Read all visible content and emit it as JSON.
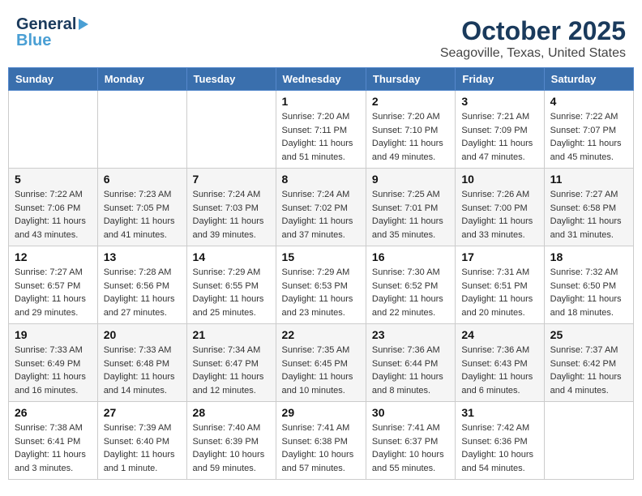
{
  "header": {
    "logo_line1": "General",
    "logo_line2": "Blue",
    "title": "October 2025",
    "subtitle": "Seagoville, Texas, United States"
  },
  "weekdays": [
    "Sunday",
    "Monday",
    "Tuesday",
    "Wednesday",
    "Thursday",
    "Friday",
    "Saturday"
  ],
  "weeks": [
    [
      {
        "day": "",
        "info": ""
      },
      {
        "day": "",
        "info": ""
      },
      {
        "day": "",
        "info": ""
      },
      {
        "day": "1",
        "info": "Sunrise: 7:20 AM\nSunset: 7:11 PM\nDaylight: 11 hours\nand 51 minutes."
      },
      {
        "day": "2",
        "info": "Sunrise: 7:20 AM\nSunset: 7:10 PM\nDaylight: 11 hours\nand 49 minutes."
      },
      {
        "day": "3",
        "info": "Sunrise: 7:21 AM\nSunset: 7:09 PM\nDaylight: 11 hours\nand 47 minutes."
      },
      {
        "day": "4",
        "info": "Sunrise: 7:22 AM\nSunset: 7:07 PM\nDaylight: 11 hours\nand 45 minutes."
      }
    ],
    [
      {
        "day": "5",
        "info": "Sunrise: 7:22 AM\nSunset: 7:06 PM\nDaylight: 11 hours\nand 43 minutes."
      },
      {
        "day": "6",
        "info": "Sunrise: 7:23 AM\nSunset: 7:05 PM\nDaylight: 11 hours\nand 41 minutes."
      },
      {
        "day": "7",
        "info": "Sunrise: 7:24 AM\nSunset: 7:03 PM\nDaylight: 11 hours\nand 39 minutes."
      },
      {
        "day": "8",
        "info": "Sunrise: 7:24 AM\nSunset: 7:02 PM\nDaylight: 11 hours\nand 37 minutes."
      },
      {
        "day": "9",
        "info": "Sunrise: 7:25 AM\nSunset: 7:01 PM\nDaylight: 11 hours\nand 35 minutes."
      },
      {
        "day": "10",
        "info": "Sunrise: 7:26 AM\nSunset: 7:00 PM\nDaylight: 11 hours\nand 33 minutes."
      },
      {
        "day": "11",
        "info": "Sunrise: 7:27 AM\nSunset: 6:58 PM\nDaylight: 11 hours\nand 31 minutes."
      }
    ],
    [
      {
        "day": "12",
        "info": "Sunrise: 7:27 AM\nSunset: 6:57 PM\nDaylight: 11 hours\nand 29 minutes."
      },
      {
        "day": "13",
        "info": "Sunrise: 7:28 AM\nSunset: 6:56 PM\nDaylight: 11 hours\nand 27 minutes."
      },
      {
        "day": "14",
        "info": "Sunrise: 7:29 AM\nSunset: 6:55 PM\nDaylight: 11 hours\nand 25 minutes."
      },
      {
        "day": "15",
        "info": "Sunrise: 7:29 AM\nSunset: 6:53 PM\nDaylight: 11 hours\nand 23 minutes."
      },
      {
        "day": "16",
        "info": "Sunrise: 7:30 AM\nSunset: 6:52 PM\nDaylight: 11 hours\nand 22 minutes."
      },
      {
        "day": "17",
        "info": "Sunrise: 7:31 AM\nSunset: 6:51 PM\nDaylight: 11 hours\nand 20 minutes."
      },
      {
        "day": "18",
        "info": "Sunrise: 7:32 AM\nSunset: 6:50 PM\nDaylight: 11 hours\nand 18 minutes."
      }
    ],
    [
      {
        "day": "19",
        "info": "Sunrise: 7:33 AM\nSunset: 6:49 PM\nDaylight: 11 hours\nand 16 minutes."
      },
      {
        "day": "20",
        "info": "Sunrise: 7:33 AM\nSunset: 6:48 PM\nDaylight: 11 hours\nand 14 minutes."
      },
      {
        "day": "21",
        "info": "Sunrise: 7:34 AM\nSunset: 6:47 PM\nDaylight: 11 hours\nand 12 minutes."
      },
      {
        "day": "22",
        "info": "Sunrise: 7:35 AM\nSunset: 6:45 PM\nDaylight: 11 hours\nand 10 minutes."
      },
      {
        "day": "23",
        "info": "Sunrise: 7:36 AM\nSunset: 6:44 PM\nDaylight: 11 hours\nand 8 minutes."
      },
      {
        "day": "24",
        "info": "Sunrise: 7:36 AM\nSunset: 6:43 PM\nDaylight: 11 hours\nand 6 minutes."
      },
      {
        "day": "25",
        "info": "Sunrise: 7:37 AM\nSunset: 6:42 PM\nDaylight: 11 hours\nand 4 minutes."
      }
    ],
    [
      {
        "day": "26",
        "info": "Sunrise: 7:38 AM\nSunset: 6:41 PM\nDaylight: 11 hours\nand 3 minutes."
      },
      {
        "day": "27",
        "info": "Sunrise: 7:39 AM\nSunset: 6:40 PM\nDaylight: 11 hours\nand 1 minute."
      },
      {
        "day": "28",
        "info": "Sunrise: 7:40 AM\nSunset: 6:39 PM\nDaylight: 10 hours\nand 59 minutes."
      },
      {
        "day": "29",
        "info": "Sunrise: 7:41 AM\nSunset: 6:38 PM\nDaylight: 10 hours\nand 57 minutes."
      },
      {
        "day": "30",
        "info": "Sunrise: 7:41 AM\nSunset: 6:37 PM\nDaylight: 10 hours\nand 55 minutes."
      },
      {
        "day": "31",
        "info": "Sunrise: 7:42 AM\nSunset: 6:36 PM\nDaylight: 10 hours\nand 54 minutes."
      },
      {
        "day": "",
        "info": ""
      }
    ]
  ]
}
